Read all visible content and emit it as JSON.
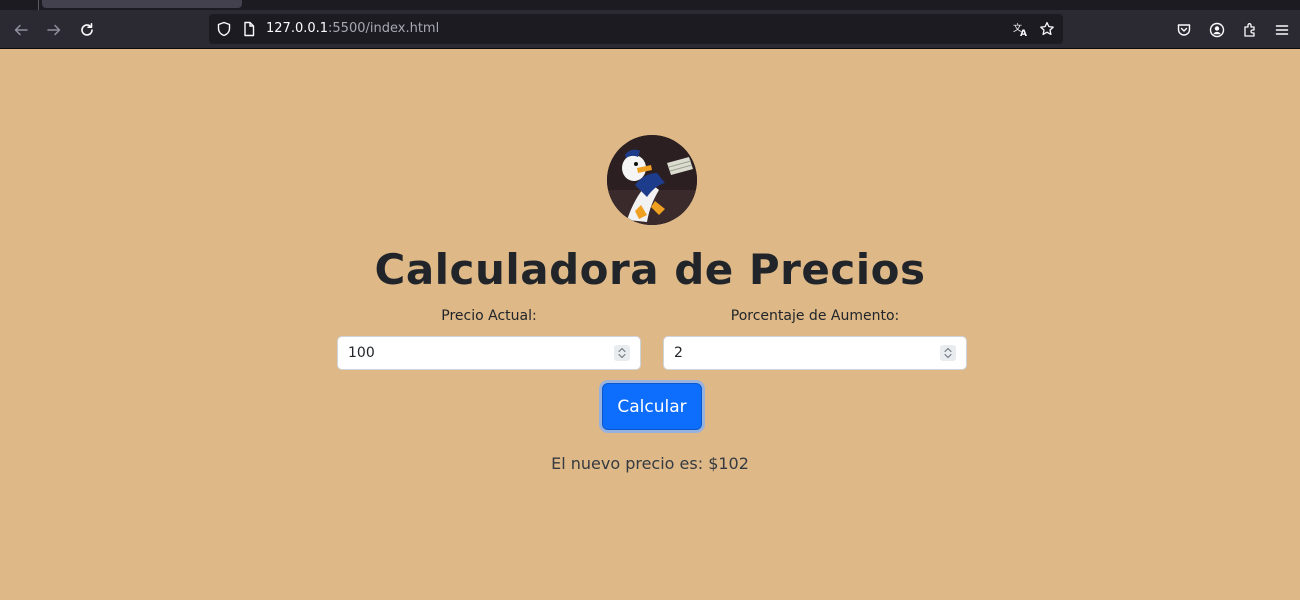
{
  "browser": {
    "url_host": "127.0.0.1",
    "url_rest": ":5500/index.html",
    "icons": {
      "back": "arrow-left-icon",
      "forward": "arrow-right-icon",
      "reload": "reload-icon",
      "shield": "shield-icon",
      "page": "page-icon",
      "translate": "translate-icon",
      "bookmark": "star-icon",
      "pocket": "pocket-icon",
      "account": "account-icon",
      "extensions": "extensions-icon",
      "menu": "hamburger-menu-icon"
    }
  },
  "page": {
    "title": "Calculadora de Precios",
    "price_label": "Precio Actual:",
    "price_value": "100",
    "percent_label": "Porcentaje de Aumento:",
    "percent_value": "2",
    "button_label": "Calcular",
    "result_text": "El nuevo precio es: $102"
  },
  "colors": {
    "background": "#deb887",
    "button": "#0d6efd",
    "title": "#212529"
  }
}
